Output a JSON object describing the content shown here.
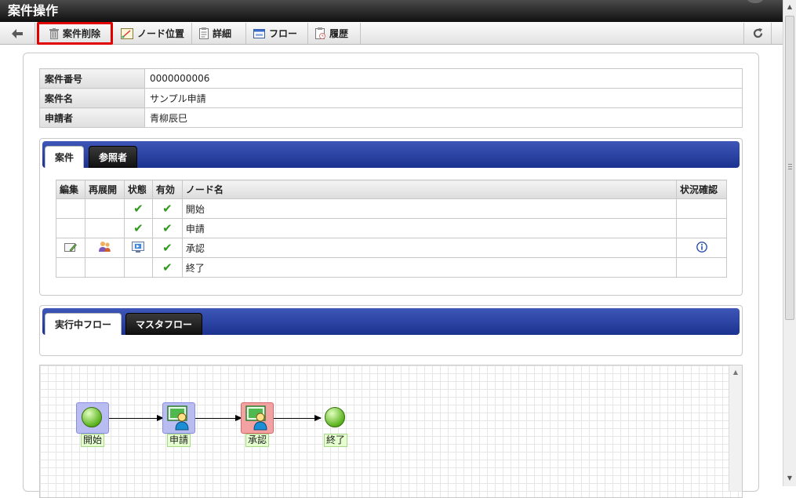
{
  "window": {
    "title": "案件操作"
  },
  "toolbar": {
    "delete_label": "案件削除",
    "node_position_label": "ノード位置",
    "detail_label": "詳細",
    "flow_label": "フロー",
    "history_label": "履歴"
  },
  "matter": {
    "rows": [
      {
        "key": "案件番号",
        "value": "0000000006"
      },
      {
        "key": "案件名",
        "value": "サンプル申請"
      },
      {
        "key": "申請者",
        "value": "青柳辰巳"
      }
    ]
  },
  "matter_tabs": {
    "tab1": "案件",
    "tab2": "参照者"
  },
  "node_table": {
    "headers": [
      "編集",
      "再展開",
      "状態",
      "有効",
      "ノード名",
      "状況確認"
    ],
    "rows": [
      {
        "name": "開始",
        "status": true,
        "valid": true
      },
      {
        "name": "申請",
        "status": true,
        "valid": true
      },
      {
        "name": "承認",
        "status": false,
        "valid": true
      },
      {
        "name": "終了",
        "status": false,
        "valid": true
      }
    ]
  },
  "flow_tabs": {
    "tab1": "実行中フロー",
    "tab2": "マスタフロー"
  },
  "flow": {
    "nodes": [
      {
        "label": "開始",
        "kind": "start"
      },
      {
        "label": "申請",
        "kind": "task"
      },
      {
        "label": "承認",
        "kind": "task-active"
      },
      {
        "label": "終了",
        "kind": "end"
      }
    ]
  },
  "icons": {
    "back": "arrow-left-icon",
    "delete": "trash-icon",
    "node_position": "node-position-icon",
    "detail": "clipboard-icon",
    "flow": "flow-window-icon",
    "history": "history-clipboard-icon",
    "reload": "reload-icon",
    "edit": "edit-icon",
    "reopen": "users-icon",
    "node_status": "monitor-icon",
    "info": "info-icon"
  },
  "colors": {
    "tab_bar": "#1b328f",
    "highlight": "#e00000",
    "check": "#2e9a1c",
    "task_node": "#b9bcf0",
    "active_node": "#f3a1a1",
    "start_end_node": "#5ab21e"
  }
}
